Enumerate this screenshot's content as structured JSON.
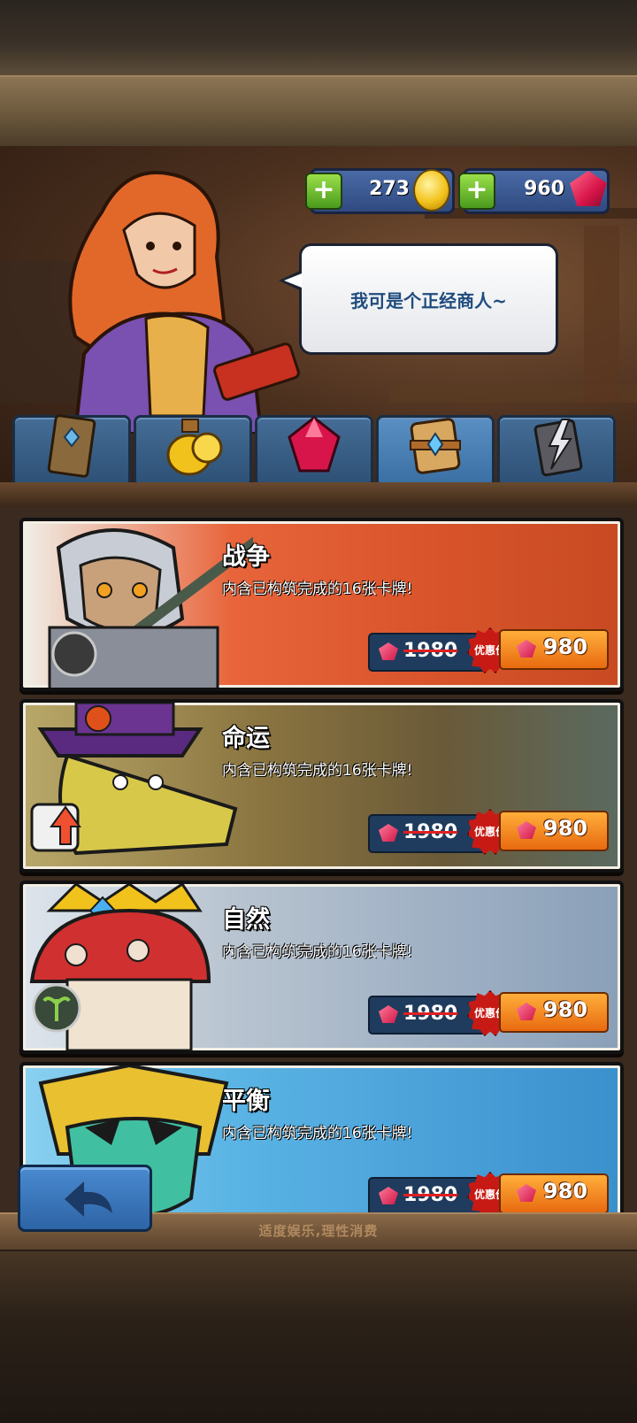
{
  "currency": {
    "coins": "273",
    "gems": "960",
    "coin_icon": "gold-coin-icon",
    "gem_icon": "ruby-gem-icon",
    "add_icon": "plus-icon"
  },
  "merchant": {
    "speech": "我可是个正经商人~"
  },
  "tabs": [
    {
      "icon": "card-pack-icon"
    },
    {
      "icon": "coin-pouch-icon"
    },
    {
      "icon": "ruby-gem-icon"
    },
    {
      "icon": "scroll-pack-icon"
    },
    {
      "icon": "lightning-cards-icon"
    }
  ],
  "packs": [
    {
      "name": "战争",
      "desc": "内含已构筑完成的16张卡牌!",
      "old_price": "1980",
      "badge": "优惠价",
      "price": "980",
      "theme": "#d8532a"
    },
    {
      "name": "命运",
      "desc": "内含已构筑完成的16张卡牌!",
      "old_price": "1980",
      "badge": "优惠价",
      "price": "980",
      "theme": "#8a7440"
    },
    {
      "name": "自然",
      "desc": "内含已构筑完成的16张卡牌!",
      "old_price": "1980",
      "badge": "优惠价",
      "price": "980",
      "theme": "#9fb0c4"
    },
    {
      "name": "平衡",
      "desc": "内含已构筑完成的16张卡牌!",
      "old_price": "1980",
      "badge": "优惠价",
      "price": "980",
      "theme": "#4aa0d8"
    }
  ],
  "back_icon": "back-arrow-icon",
  "footer": "适度娱乐,理性消费"
}
